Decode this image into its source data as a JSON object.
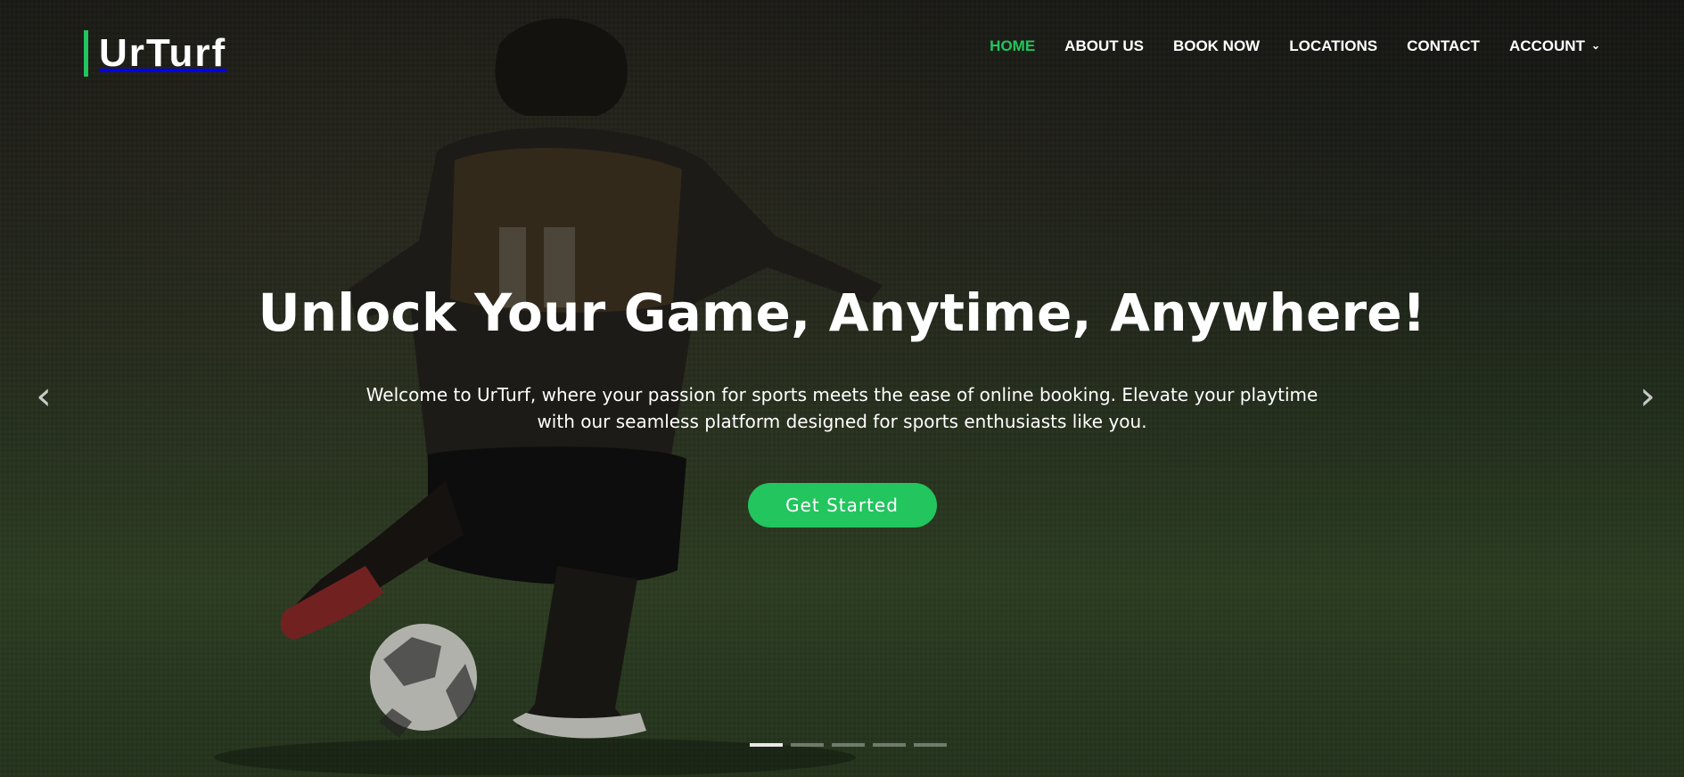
{
  "site": {
    "logo": "UrTurf"
  },
  "navigation": {
    "items": [
      {
        "label": "HOME",
        "active": true
      },
      {
        "label": "ABOUT US",
        "active": false
      },
      {
        "label": "BOOK NOW",
        "active": false
      },
      {
        "label": "LOCATIONS",
        "active": false
      },
      {
        "label": "CONTACT",
        "active": false
      },
      {
        "label": "ACCOUNT",
        "active": false,
        "icon": "chevron-down-icon"
      }
    ]
  },
  "hero": {
    "headline": "Unlock Your Game, Anytime, Anywhere!",
    "subtext": "Welcome to UrTurf, where your passion for sports meets the ease of online booking. Elevate your playtime with our seamless platform designed for sports enthusiasts like you.",
    "cta_label": "Get Started",
    "background_icon": "football-player-kicking-ball-image"
  },
  "carousel": {
    "prev_icon": "chevron-left-icon",
    "next_icon": "chevron-right-icon",
    "slide_count": 5,
    "active_slide": 1
  },
  "colors": {
    "accent": "#22c55e",
    "text": "#ffffff",
    "overlay": "#000000"
  }
}
